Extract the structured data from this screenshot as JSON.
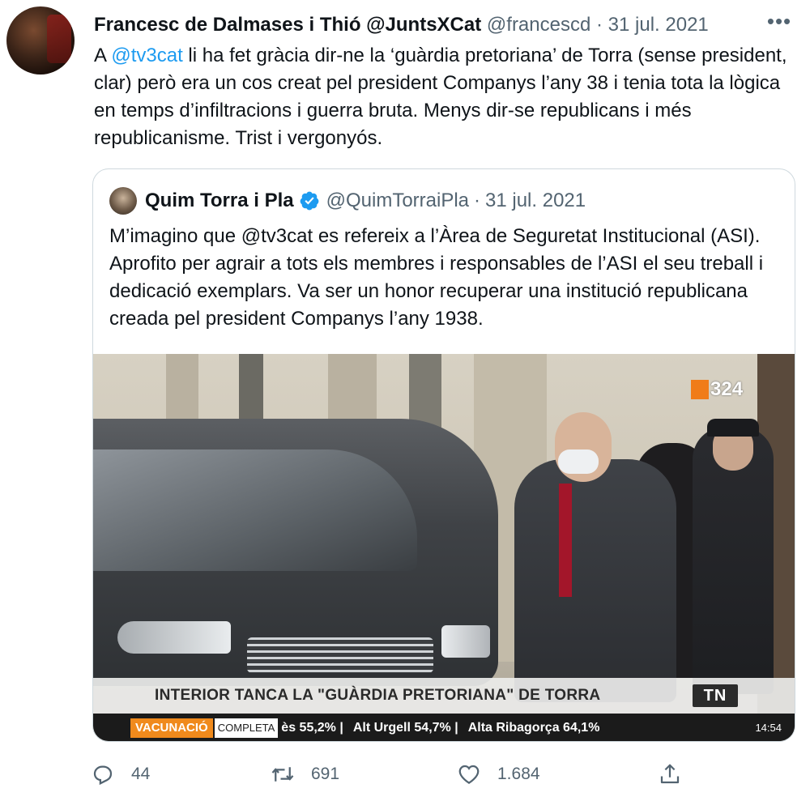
{
  "tweet": {
    "author_name": "Francesc de Dalmases i Thió @JuntsXCat",
    "handle": "@francescd",
    "separator": "·",
    "date": "31 jul. 2021",
    "text_prefix": "A ",
    "mention": "@tv3cat",
    "text_rest": " li ha fet gràcia dir-ne la ‘guàrdia pretoriana’ de Torra (sense president, clar) però era un cos creat pel president Companys l’any 38 i tenia tota la lògica en temps d’infiltracions i guerra bruta. Menys dir-se republicans i més republicanisme. Trist i vergonyós."
  },
  "quote": {
    "author_name": "Quim Torra i Pla",
    "handle": "@QuimTorraiPla",
    "separator": "·",
    "date": "31 jul. 2021",
    "text": "M’imagino que @tv3cat es refereix a l’Àrea de Seguretat Institucional (ASI). Aprofito per agrair a tots els membres i responsables de l’ASI el seu treball i dedicació exemplars. Va ser un honor recuperar una institució republicana creada pel president Companys l’any 1938.",
    "media": {
      "channel_logo": "324",
      "headline": "INTERIOR TANCA LA \"GUÀRDIA PRETORIANA\" DE TORRA",
      "program_logo": "TN",
      "ticker_tag": "VACUNACIÓ",
      "ticker_tag2": "COMPLETA",
      "ticker_items": [
        "ès  55,2% |",
        "Alt Urgell  54,7% |",
        "Alta Ribagorça  64,1%"
      ],
      "ticker_time": "14:54"
    }
  },
  "actions": {
    "reply_count": "44",
    "retweet_count": "691",
    "like_count": "1.684"
  },
  "colors": {
    "accent": "#1d9bf0",
    "secondary_text": "#536471",
    "border": "#cfd9de"
  }
}
